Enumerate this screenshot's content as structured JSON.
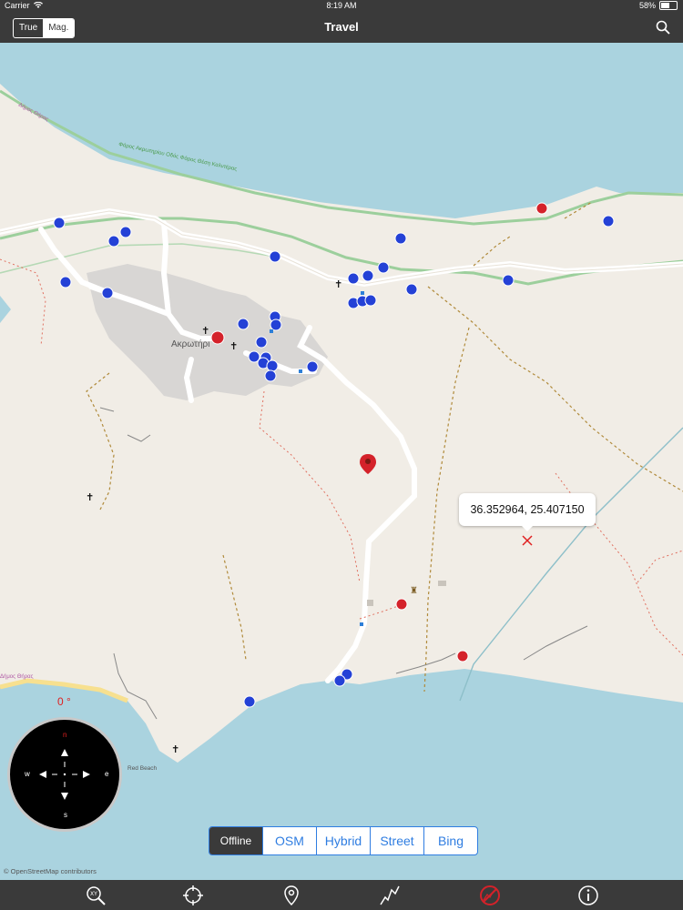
{
  "status_bar": {
    "carrier": "Carrier",
    "time": "8:19 AM",
    "battery": "58%",
    "battery_level": 0.58
  },
  "nav": {
    "title": "Travel",
    "north_toggle": {
      "options": [
        "True",
        "Mag."
      ],
      "selected": "Mag."
    },
    "search_icon": "search-icon"
  },
  "map": {
    "place_label": "Ακρωτήρι",
    "road_label_1": "Δήμος Θήρας",
    "road_label_2": "Φάρος Ακρωτηρίου Οδός Φάρος Θέση Καλντέρας",
    "road_label_3": "Δήμος Θήρας",
    "beach_label": "Red Beach",
    "coordinate_popup": "36.352964, 25.407150",
    "attribution": "© OpenStreetMap contributors",
    "colors": {
      "sea": "#aad3df",
      "land": "#f1ede6",
      "urban": "#d8d6d4",
      "pin": "#d4222a",
      "poi": "#2441d6"
    }
  },
  "compass": {
    "heading": "0 °",
    "labels": {
      "n": "n",
      "e": "e",
      "s": "s",
      "w": "w"
    }
  },
  "map_types": {
    "options": [
      "Offline",
      "OSM",
      "Hybrid",
      "Street",
      "Bing"
    ],
    "selected": "Offline"
  },
  "toolbar": {
    "items": [
      "xy-zoom-icon",
      "locate-crosshair-icon",
      "map-pin-icon",
      "track-path-icon",
      "no-track-icon",
      "info-icon"
    ]
  }
}
